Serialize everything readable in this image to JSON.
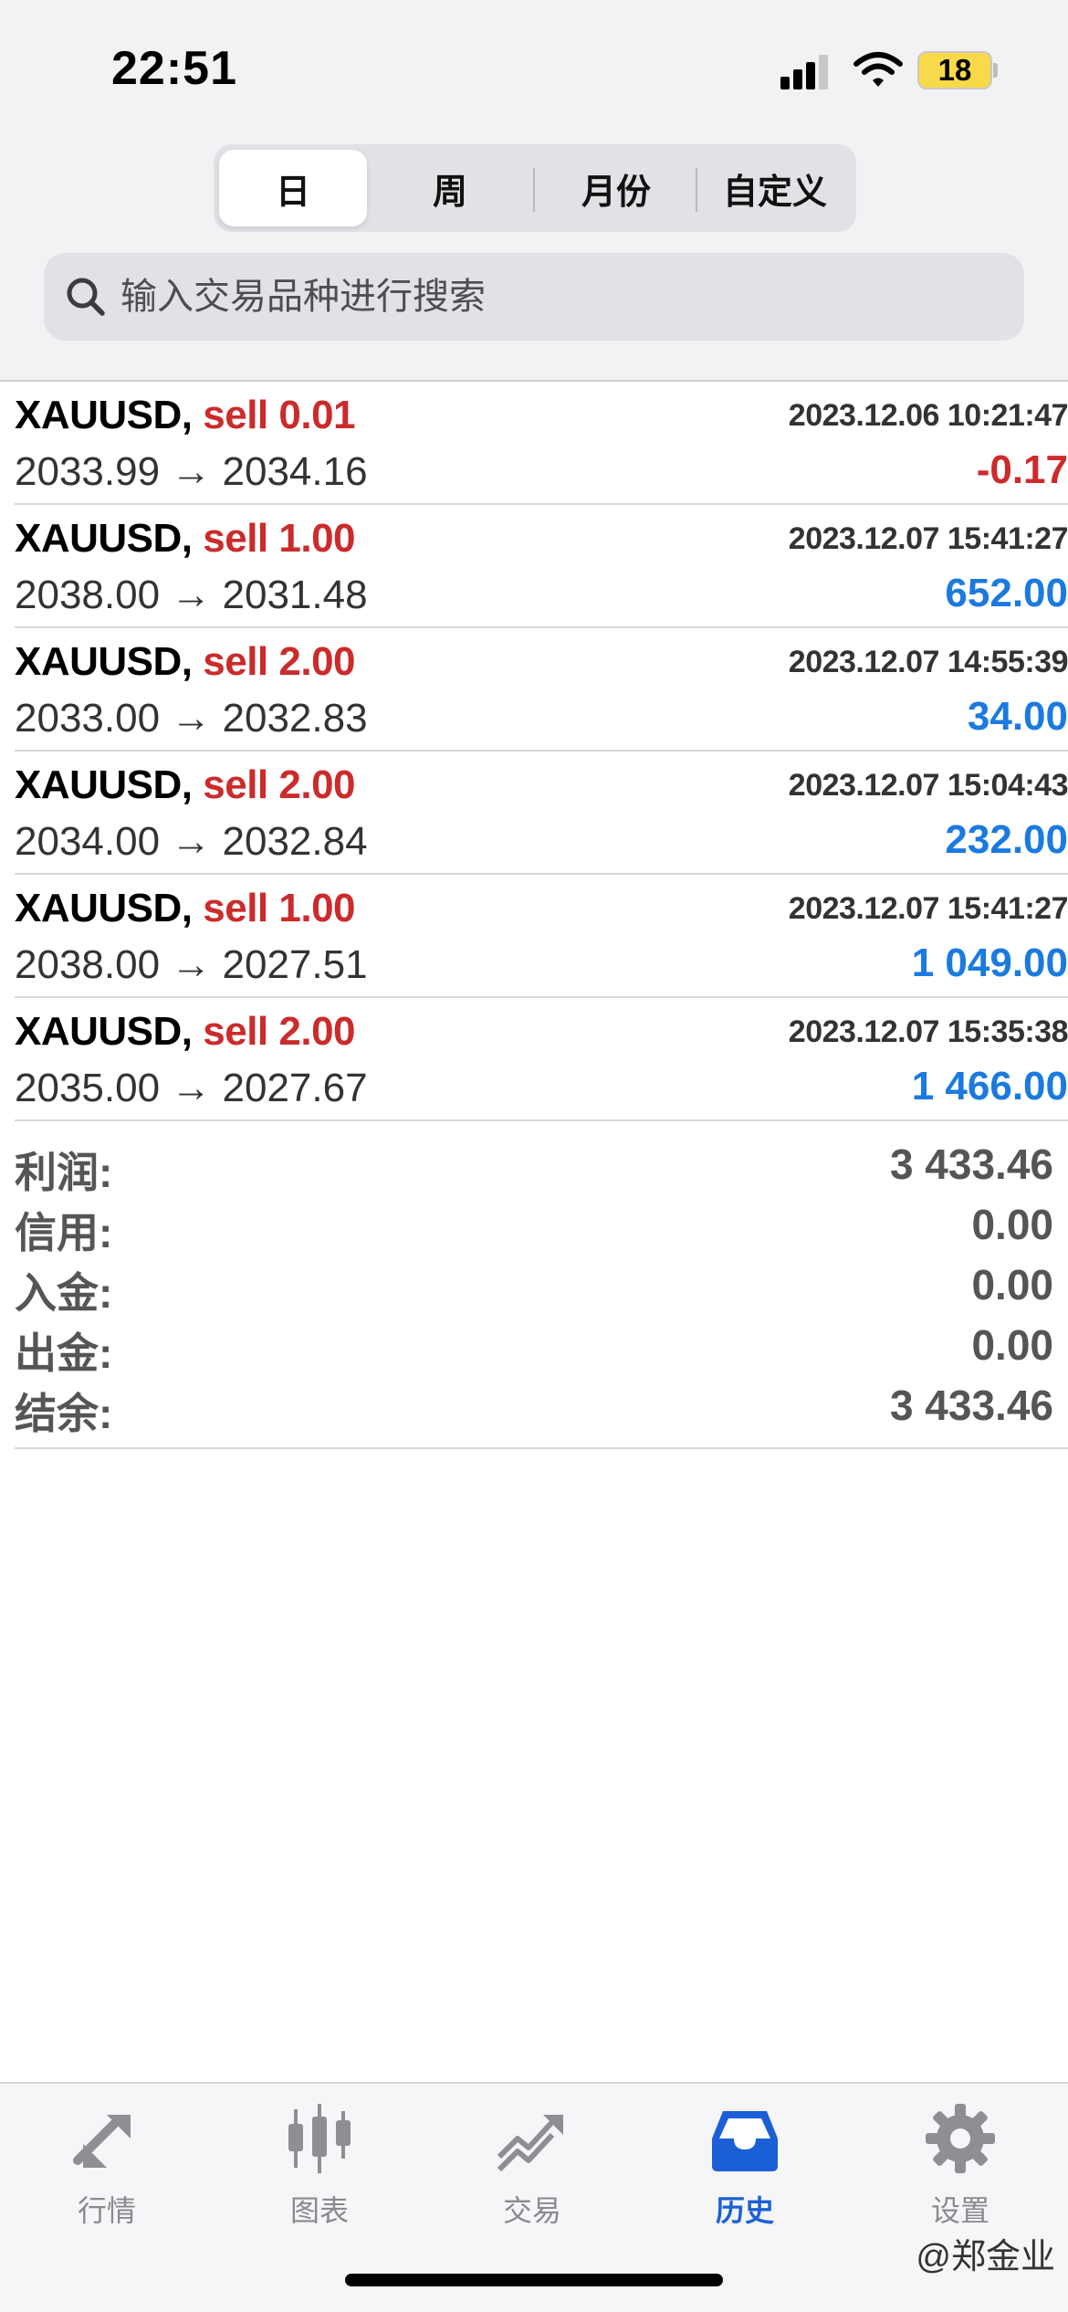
{
  "status_bar": {
    "time": "22:51",
    "battery": "18"
  },
  "segments": [
    {
      "label": "日",
      "active": true
    },
    {
      "label": "周",
      "active": false
    },
    {
      "label": "月份",
      "active": false
    },
    {
      "label": "自定义",
      "active": false
    }
  ],
  "search": {
    "placeholder": "输入交易品种进行搜索"
  },
  "trades": [
    {
      "symbol": "XAUUSD,",
      "side": "sell 0.01",
      "time": "2023.12.06 10:21:47",
      "prices": "2033.99 → 2034.16",
      "profit": "-0.17"
    },
    {
      "symbol": "XAUUSD,",
      "side": "sell 1.00",
      "time": "2023.12.07 15:41:27",
      "prices": "2038.00 → 2031.48",
      "profit": "652.00"
    },
    {
      "symbol": "XAUUSD,",
      "side": "sell 2.00",
      "time": "2023.12.07 14:55:39",
      "prices": "2033.00 → 2032.83",
      "profit": "34.00"
    },
    {
      "symbol": "XAUUSD,",
      "side": "sell 2.00",
      "time": "2023.12.07 15:04:43",
      "prices": "2034.00 → 2032.84",
      "profit": "232.00"
    },
    {
      "symbol": "XAUUSD,",
      "side": "sell 1.00",
      "time": "2023.12.07 15:41:27",
      "prices": "2038.00 → 2027.51",
      "profit": "1 049.00"
    },
    {
      "symbol": "XAUUSD,",
      "side": "sell 2.00",
      "time": "2023.12.07 15:35:38",
      "prices": "2035.00 → 2027.67",
      "profit": "1 466.00"
    }
  ],
  "summary": [
    {
      "label": "利润:",
      "value": "3 433.46"
    },
    {
      "label": "信用:",
      "value": "0.00"
    },
    {
      "label": "入金:",
      "value": "0.00"
    },
    {
      "label": "出金:",
      "value": "0.00"
    },
    {
      "label": "结余:",
      "value": "3 433.46"
    }
  ],
  "tabs": [
    {
      "label": "行情",
      "icon": "quotes-arrows-icon",
      "active": false
    },
    {
      "label": "图表",
      "icon": "candlestick-chart-icon",
      "active": false
    },
    {
      "label": "交易",
      "icon": "trade-trend-icon",
      "active": false
    },
    {
      "label": "历史",
      "icon": "history-inbox-icon",
      "active": true
    },
    {
      "label": "设置",
      "icon": "gear-icon",
      "active": false
    }
  ],
  "watermark": "@郑金业",
  "colors": {
    "sell": "#cc2b2b",
    "profit_positive": "#1b7ae0",
    "profit_negative": "#cc2b2b",
    "active_tab": "#1b5fd6"
  }
}
